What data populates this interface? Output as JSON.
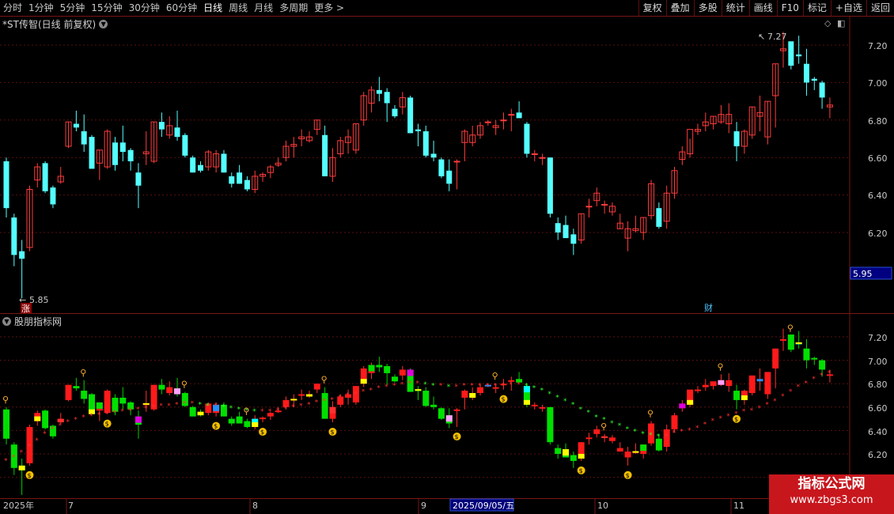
{
  "toolbar": {
    "periods": [
      "分时",
      "1分钟",
      "5分钟",
      "15分钟",
      "30分钟",
      "60分钟",
      "日线",
      "周线",
      "月线",
      "多周期",
      "更多 >"
    ],
    "active_period": "日线",
    "right_buttons": [
      "复权",
      "叠加",
      "多股",
      "统计",
      "画线",
      "F10",
      "标记",
      "+自选",
      "返回"
    ]
  },
  "main_panel": {
    "title": "*ST传智(日线 前复权)",
    "high_label": "7.27",
    "low_label": "5.85",
    "price_marker": "5.95",
    "badge_zhang": "涨",
    "badge_cai": "财",
    "axis_ticks": [
      "7.20",
      "7.00",
      "6.80",
      "6.60",
      "6.40",
      "6.20"
    ]
  },
  "sub_panel": {
    "title": "股朋指标网",
    "axis_ticks": [
      "7.20",
      "7.00",
      "6.80",
      "6.60",
      "6.40",
      "6.20"
    ]
  },
  "date_axis": {
    "labels": [
      "2025年",
      "7",
      "8",
      "9",
      "10",
      "11"
    ],
    "cursor_date": "2025/09/05/五"
  },
  "watermark": {
    "title": "指标公式网",
    "url": "www.zbgs3.com"
  },
  "colors": {
    "up": "#ff3c3c",
    "down": "#54ffff",
    "grid": "#5a0f0f",
    "axis_text": "#c8c8c8",
    "accent": "#c8161d"
  },
  "chart_data": {
    "type": "candlestick",
    "ylim": [
      5.8,
      7.32
    ],
    "candles": [
      [
        6.58,
        6.6,
        6.28,
        6.33
      ],
      [
        6.28,
        6.3,
        6.02,
        6.08
      ],
      [
        6.1,
        6.16,
        5.85,
        6.06
      ],
      [
        6.12,
        6.45,
        6.1,
        6.43
      ],
      [
        6.48,
        6.57,
        6.44,
        6.55
      ],
      [
        6.57,
        6.58,
        6.41,
        6.42
      ],
      [
        6.44,
        6.45,
        6.33,
        6.35
      ],
      [
        6.47,
        6.55,
        6.46,
        6.5
      ],
      [
        6.66,
        6.79,
        6.65,
        6.79
      ],
      [
        6.78,
        6.85,
        6.74,
        6.76
      ],
      [
        6.74,
        6.83,
        6.63,
        6.67
      ],
      [
        6.71,
        6.72,
        6.54,
        6.54
      ],
      [
        6.57,
        6.64,
        6.48,
        6.64
      ],
      [
        6.55,
        6.75,
        6.54,
        6.74
      ],
      [
        6.68,
        6.71,
        6.53,
        6.56
      ],
      [
        6.68,
        6.77,
        6.58,
        6.63
      ],
      [
        6.64,
        6.65,
        6.53,
        6.58
      ],
      [
        6.52,
        6.57,
        6.33,
        6.45
      ],
      [
        6.62,
        6.74,
        6.56,
        6.63
      ],
      [
        6.58,
        6.79,
        6.57,
        6.79
      ],
      [
        6.79,
        6.84,
        6.71,
        6.75
      ],
      [
        6.72,
        6.82,
        6.7,
        6.77
      ],
      [
        6.76,
        6.85,
        6.69,
        6.71
      ],
      [
        6.72,
        6.73,
        6.6,
        6.61
      ],
      [
        6.6,
        6.61,
        6.52,
        6.52
      ],
      [
        6.56,
        6.58,
        6.52,
        6.53
      ],
      [
        6.55,
        6.64,
        6.53,
        6.63
      ],
      [
        6.55,
        6.64,
        6.52,
        6.62
      ],
      [
        6.62,
        6.64,
        6.52,
        6.52
      ],
      [
        6.5,
        6.52,
        6.44,
        6.46
      ],
      [
        6.52,
        6.56,
        6.46,
        6.46
      ],
      [
        6.48,
        6.5,
        6.42,
        6.43
      ],
      [
        6.43,
        6.53,
        6.41,
        6.5
      ],
      [
        6.5,
        6.52,
        6.47,
        6.51
      ],
      [
        6.52,
        6.56,
        6.49,
        6.55
      ],
      [
        6.56,
        6.6,
        6.55,
        6.57
      ],
      [
        6.6,
        6.69,
        6.58,
        6.66
      ],
      [
        6.66,
        6.71,
        6.6,
        6.67
      ],
      [
        6.7,
        6.75,
        6.66,
        6.71
      ],
      [
        6.69,
        6.74,
        6.68,
        6.71
      ],
      [
        6.75,
        6.8,
        6.72,
        6.8
      ],
      [
        6.72,
        6.77,
        6.5,
        6.5
      ],
      [
        6.5,
        6.65,
        6.47,
        6.6
      ],
      [
        6.62,
        6.71,
        6.6,
        6.69
      ],
      [
        6.68,
        6.75,
        6.62,
        6.71
      ],
      [
        6.64,
        6.78,
        6.62,
        6.78
      ],
      [
        6.8,
        6.95,
        6.77,
        6.93
      ],
      [
        6.89,
        6.98,
        6.84,
        6.96
      ],
      [
        6.96,
        7.03,
        6.9,
        6.94
      ],
      [
        6.95,
        6.97,
        6.79,
        6.89
      ],
      [
        6.86,
        6.88,
        6.81,
        6.82
      ],
      [
        6.87,
        6.95,
        6.83,
        6.92
      ],
      [
        6.92,
        6.93,
        6.73,
        6.73
      ],
      [
        6.75,
        6.78,
        6.66,
        6.74
      ],
      [
        6.74,
        6.77,
        6.6,
        6.61
      ],
      [
        6.62,
        6.69,
        6.58,
        6.6
      ],
      [
        6.59,
        6.6,
        6.49,
        6.5
      ],
      [
        6.53,
        6.59,
        6.42,
        6.46
      ],
      [
        6.58,
        6.59,
        6.43,
        6.58
      ],
      [
        6.68,
        6.75,
        6.58,
        6.74
      ],
      [
        6.68,
        6.77,
        6.66,
        6.72
      ],
      [
        6.72,
        6.79,
        6.7,
        6.77
      ],
      [
        6.79,
        6.8,
        6.77,
        6.79
      ],
      [
        6.76,
        6.8,
        6.72,
        6.77
      ],
      [
        6.8,
        6.84,
        6.75,
        6.8
      ],
      [
        6.83,
        6.86,
        6.74,
        6.83
      ],
      [
        6.84,
        6.9,
        6.81,
        6.81
      ],
      [
        6.78,
        6.79,
        6.6,
        6.62
      ],
      [
        6.62,
        6.64,
        6.58,
        6.62
      ],
      [
        6.6,
        6.62,
        6.56,
        6.6
      ],
      [
        6.6,
        6.6,
        6.28,
        6.3
      ],
      [
        6.25,
        6.28,
        6.16,
        6.2
      ],
      [
        6.24,
        6.29,
        6.18,
        6.17
      ],
      [
        6.19,
        6.22,
        6.08,
        6.14
      ],
      [
        6.16,
        6.3,
        6.14,
        6.3
      ],
      [
        6.34,
        6.38,
        6.28,
        6.34
      ],
      [
        6.37,
        6.44,
        6.34,
        6.41
      ],
      [
        6.35,
        6.37,
        6.3,
        6.35
      ],
      [
        6.31,
        6.36,
        6.29,
        6.34
      ],
      [
        6.22,
        6.3,
        6.22,
        6.25
      ],
      [
        6.17,
        6.26,
        6.1,
        6.22
      ],
      [
        6.21,
        6.29,
        6.2,
        6.22
      ],
      [
        6.2,
        6.28,
        6.16,
        6.28
      ],
      [
        6.29,
        6.48,
        6.27,
        6.46
      ],
      [
        6.33,
        6.36,
        6.22,
        6.23
      ],
      [
        6.26,
        6.45,
        6.22,
        6.41
      ],
      [
        6.41,
        6.55,
        6.38,
        6.53
      ],
      [
        6.59,
        6.66,
        6.56,
        6.63
      ],
      [
        6.62,
        6.7,
        6.6,
        6.75
      ],
      [
        6.74,
        6.78,
        6.72,
        6.75
      ],
      [
        6.77,
        6.84,
        6.74,
        6.79
      ],
      [
        6.78,
        6.82,
        6.75,
        6.82
      ],
      [
        6.79,
        6.88,
        6.78,
        6.83
      ],
      [
        6.78,
        6.89,
        6.73,
        6.83
      ],
      [
        6.74,
        6.79,
        6.58,
        6.66
      ],
      [
        6.66,
        6.75,
        6.62,
        6.74
      ],
      [
        6.72,
        6.87,
        6.7,
        6.87
      ],
      [
        6.82,
        6.93,
        6.74,
        6.84
      ],
      [
        6.71,
        6.9,
        6.67,
        6.9
      ],
      [
        6.93,
        7.1,
        6.76,
        7.1
      ],
      [
        7.17,
        7.27,
        7.08,
        7.18
      ],
      [
        7.22,
        7.21,
        7.07,
        7.09
      ],
      [
        7.15,
        7.25,
        7.1,
        7.14
      ],
      [
        7.1,
        7.18,
        6.93,
        7.0
      ],
      [
        7.02,
        7.03,
        6.96,
        7.01
      ],
      [
        7.0,
        7.01,
        6.86,
        6.92
      ],
      [
        6.87,
        6.92,
        6.81,
        6.88
      ]
    ],
    "indicator_line": [
      6.15,
      6.18,
      6.22,
      6.27,
      6.32,
      6.38,
      6.42,
      6.45,
      6.48,
      6.5,
      6.52,
      6.53,
      6.54,
      6.55,
      6.56,
      6.57,
      6.58,
      6.59,
      6.6,
      6.61,
      6.62,
      6.62,
      6.63,
      6.64,
      6.64,
      6.63,
      6.62,
      6.62,
      6.61,
      6.6,
      6.59,
      6.58,
      6.57,
      6.57,
      6.57,
      6.58,
      6.6,
      6.61,
      6.62,
      6.63,
      6.65,
      6.66,
      6.67,
      6.69,
      6.71,
      6.72,
      6.74,
      6.75,
      6.77,
      6.78,
      6.79,
      6.8,
      6.81,
      6.81,
      6.8,
      6.79,
      6.79,
      6.78,
      6.78,
      6.79,
      6.79,
      6.79,
      6.79,
      6.79,
      6.79,
      6.8,
      6.8,
      6.79,
      6.77,
      6.75,
      6.72,
      6.69,
      6.66,
      6.63,
      6.59,
      6.56,
      6.52,
      6.5,
      6.47,
      6.45,
      6.42,
      6.4,
      6.38,
      6.37,
      6.36,
      6.36,
      6.39,
      6.4,
      6.41,
      6.43,
      6.46,
      6.49,
      6.51,
      6.53,
      6.55,
      6.57,
      6.58,
      6.6,
      6.63,
      6.66,
      6.7,
      6.74,
      6.78,
      6.81,
      6.85,
      6.88,
      6.9
    ]
  }
}
